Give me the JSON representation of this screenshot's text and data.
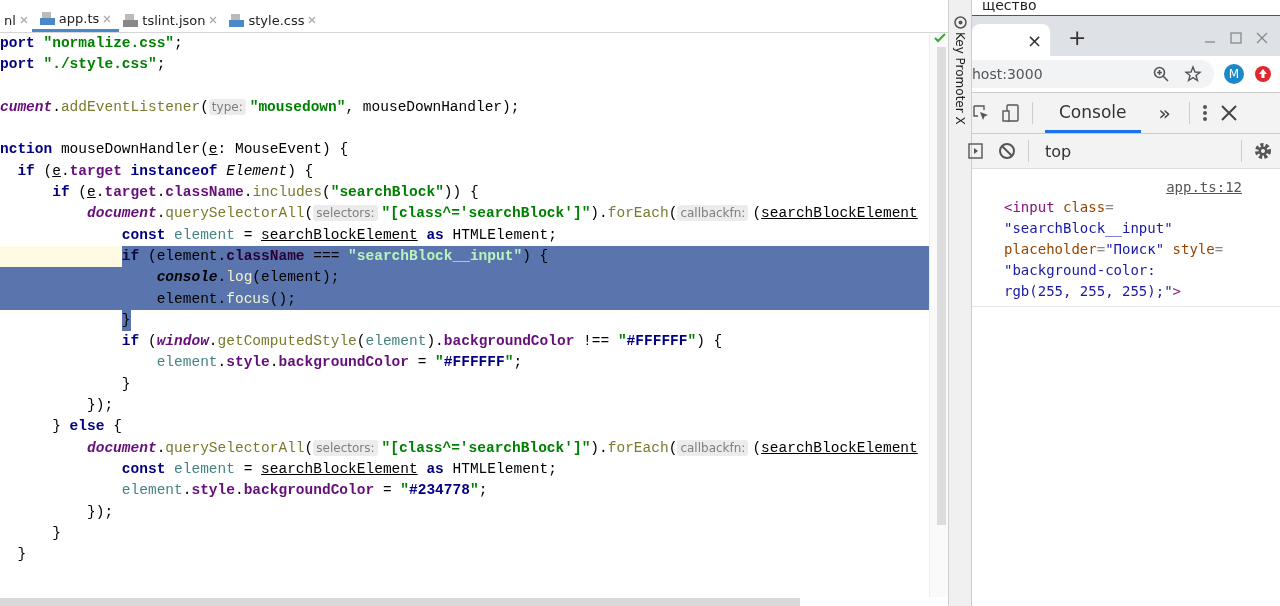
{
  "editor": {
    "tabs": [
      {
        "label": "nl",
        "selected": false,
        "kind": "plain"
      },
      {
        "label": "app.ts",
        "selected": true,
        "kind": "ts"
      },
      {
        "label": "tslint.json",
        "selected": false,
        "kind": "json"
      },
      {
        "label": "style.css",
        "selected": false,
        "kind": "css"
      }
    ],
    "lines": [
      {
        "selected": false,
        "tokens": [
          {
            "kind": "kw",
            "text": "port"
          },
          {
            "kind": "str",
            "text": " \"normalize.css\""
          },
          {
            "kind": "plain",
            "text": ";"
          }
        ]
      },
      {
        "selected": false,
        "tokens": [
          {
            "kind": "kw",
            "text": "port"
          },
          {
            "kind": "str",
            "text": " \"./style.css\""
          },
          {
            "kind": "plain",
            "text": ";"
          }
        ]
      },
      {
        "selected": false
      },
      {
        "selected": false,
        "tokens": [
          {
            "kind": "glob",
            "text": "cument"
          },
          {
            "kind": "plain",
            "text": "."
          },
          {
            "kind": "fn",
            "text": "addEventListener"
          },
          {
            "kind": "plain",
            "text": "("
          },
          {
            "kind": "hint",
            "text": "type:"
          },
          {
            "kind": "str",
            "text": "\"mousedown\""
          },
          {
            "kind": "plain",
            "text": ", mouseDownHandler);"
          }
        ]
      },
      {
        "selected": false
      },
      {
        "selected": false,
        "tokens": [
          {
            "kind": "kw",
            "text": "nction"
          },
          {
            "kind": "plain",
            "text": " mouseDownHandler("
          },
          {
            "kind": "param",
            "text": "e"
          },
          {
            "kind": "plain",
            "text": ": MouseEvent) {"
          }
        ]
      },
      {
        "selected": false,
        "tokens": [
          {
            "kind": "kw",
            "text": "  if"
          },
          {
            "kind": "plain",
            "text": " ("
          },
          {
            "kind": "param",
            "text": "e"
          },
          {
            "kind": "plain",
            "text": "."
          },
          {
            "kind": "field",
            "text": "target"
          },
          {
            "kind": "kw",
            "text": " instanceof"
          },
          {
            "kind": "type",
            "text": " Element"
          },
          {
            "kind": "plain",
            "text": ") {"
          }
        ]
      },
      {
        "selected": false,
        "tokens": [
          {
            "kind": "kw",
            "text": "      if"
          },
          {
            "kind": "plain",
            "text": " ("
          },
          {
            "kind": "param",
            "text": "e"
          },
          {
            "kind": "plain",
            "text": "."
          },
          {
            "kind": "field",
            "text": "target"
          },
          {
            "kind": "plain",
            "text": "."
          },
          {
            "kind": "field",
            "text": "className"
          },
          {
            "kind": "plain",
            "text": "."
          },
          {
            "kind": "fn",
            "text": "includes"
          },
          {
            "kind": "plain",
            "text": "("
          },
          {
            "kind": "str",
            "text": "\"searchBlock\""
          },
          {
            "kind": "plain",
            "text": ")) {"
          }
        ]
      },
      {
        "selected": false,
        "tokens": [
          {
            "kind": "glob",
            "text": "          document"
          },
          {
            "kind": "plain",
            "text": "."
          },
          {
            "kind": "fn",
            "text": "querySelectorAll"
          },
          {
            "kind": "plain",
            "text": "("
          },
          {
            "kind": "hint",
            "text": "selectors:"
          },
          {
            "kind": "str",
            "text": "\"[class^='searchBlock']\""
          },
          {
            "kind": "plain",
            "text": ")."
          },
          {
            "kind": "fn",
            "text": "forEach"
          },
          {
            "kind": "plain",
            "text": "("
          },
          {
            "kind": "hint",
            "text": "callbackfn:"
          },
          {
            "kind": "plain",
            "text": "("
          },
          {
            "kind": "param",
            "text": "searchBlockElement"
          }
        ]
      },
      {
        "selected": false,
        "tokens": [
          {
            "kind": "kw",
            "text": "              const"
          },
          {
            "kind": "local",
            "text": " element"
          },
          {
            "kind": "plain",
            "text": " = "
          },
          {
            "kind": "param",
            "text": "searchBlockElement"
          },
          {
            "kind": "kw",
            "text": " as"
          },
          {
            "kind": "plain",
            "text": " HTMLElement;"
          }
        ]
      },
      {
        "selected": true,
        "tokens": [
          {
            "kind": "kw",
            "text": "              if"
          },
          {
            "kind": "plain",
            "text": " (element."
          },
          {
            "kind": "field",
            "text": "className"
          },
          {
            "kind": "plain",
            "text": " === "
          },
          {
            "kind": "str",
            "text": "\"searchBlock__input\""
          },
          {
            "kind": "plain",
            "text": ") {"
          }
        ]
      },
      {
        "selected": true,
        "tokens": [
          {
            "kind": "glob",
            "text": "                  console"
          },
          {
            "kind": "plain",
            "text": "."
          },
          {
            "kind": "fn",
            "text": "log"
          },
          {
            "kind": "plain",
            "text": "(element);"
          }
        ]
      },
      {
        "selected": true,
        "tokens": [
          {
            "kind": "plain",
            "text": "                  element."
          },
          {
            "kind": "fn",
            "text": "focus"
          },
          {
            "kind": "plain",
            "text": "();"
          }
        ]
      },
      {
        "selected": true,
        "tokens": [
          {
            "kind": "plain",
            "text": "              }"
          }
        ]
      },
      {
        "selected": false,
        "tokens": [
          {
            "kind": "kw",
            "text": "              if"
          },
          {
            "kind": "plain",
            "text": " ("
          },
          {
            "kind": "glob",
            "text": "window"
          },
          {
            "kind": "plain",
            "text": "."
          },
          {
            "kind": "fn",
            "text": "getComputedStyle"
          },
          {
            "kind": "plain",
            "text": "("
          },
          {
            "kind": "local",
            "text": "element"
          },
          {
            "kind": "plain",
            "text": ")."
          },
          {
            "kind": "field",
            "text": "backgroundColor"
          },
          {
            "kind": "plain",
            "text": " !== "
          },
          {
            "kind": "str",
            "text": "\""
          },
          {
            "kind": "hex",
            "text": "#FFFFFF"
          },
          {
            "kind": "str",
            "text": "\""
          },
          {
            "kind": "plain",
            "text": ") {"
          }
        ]
      },
      {
        "selected": false,
        "tokens": [
          {
            "kind": "local",
            "text": "                  element"
          },
          {
            "kind": "plain",
            "text": "."
          },
          {
            "kind": "field",
            "text": "style"
          },
          {
            "kind": "plain",
            "text": "."
          },
          {
            "kind": "field",
            "text": "backgroundColor"
          },
          {
            "kind": "plain",
            "text": " = "
          },
          {
            "kind": "str",
            "text": "\""
          },
          {
            "kind": "hex",
            "text": "#FFFFFF"
          },
          {
            "kind": "str",
            "text": "\""
          },
          {
            "kind": "plain",
            "text": ";"
          }
        ]
      },
      {
        "selected": false,
        "tokens": [
          {
            "kind": "plain",
            "text": "              }"
          }
        ]
      },
      {
        "selected": false,
        "tokens": [
          {
            "kind": "plain",
            "text": "          });"
          }
        ]
      },
      {
        "selected": false,
        "tokens": [
          {
            "kind": "plain",
            "text": "      }"
          },
          {
            "kind": "kw",
            "text": " else"
          },
          {
            "kind": "plain",
            "text": " {"
          }
        ]
      },
      {
        "selected": false,
        "tokens": [
          {
            "kind": "glob",
            "text": "          document"
          },
          {
            "kind": "plain",
            "text": "."
          },
          {
            "kind": "fn",
            "text": "querySelectorAll"
          },
          {
            "kind": "plain",
            "text": "("
          },
          {
            "kind": "hint",
            "text": "selectors:"
          },
          {
            "kind": "str",
            "text": "\"[class^='searchBlock']\""
          },
          {
            "kind": "plain",
            "text": ")."
          },
          {
            "kind": "fn",
            "text": "forEach"
          },
          {
            "kind": "plain",
            "text": "("
          },
          {
            "kind": "hint",
            "text": "callbackfn:"
          },
          {
            "kind": "plain",
            "text": "("
          },
          {
            "kind": "param",
            "text": "searchBlockElement"
          }
        ]
      },
      {
        "selected": false,
        "tokens": [
          {
            "kind": "kw",
            "text": "              const"
          },
          {
            "kind": "local",
            "text": " element"
          },
          {
            "kind": "plain",
            "text": " = "
          },
          {
            "kind": "param",
            "text": "searchBlockElement"
          },
          {
            "kind": "kw",
            "text": " as"
          },
          {
            "kind": "plain",
            "text": " HTMLElement;"
          }
        ]
      },
      {
        "selected": false,
        "tokens": [
          {
            "kind": "local",
            "text": "              element"
          },
          {
            "kind": "plain",
            "text": "."
          },
          {
            "kind": "field",
            "text": "style"
          },
          {
            "kind": "plain",
            "text": "."
          },
          {
            "kind": "field",
            "text": "backgroundColor"
          },
          {
            "kind": "plain",
            "text": " = "
          },
          {
            "kind": "str",
            "text": "\""
          },
          {
            "kind": "hex",
            "text": "#234778"
          },
          {
            "kind": "str",
            "text": "\""
          },
          {
            "kind": "plain",
            "text": ";"
          }
        ]
      },
      {
        "selected": false,
        "tokens": [
          {
            "kind": "plain",
            "text": "          });"
          }
        ]
      },
      {
        "selected": false,
        "tokens": [
          {
            "kind": "plain",
            "text": "      }"
          }
        ]
      },
      {
        "selected": false,
        "tokens": [
          {
            "kind": "plain",
            "text": "  }"
          }
        ]
      }
    ]
  },
  "side_tool": {
    "label": "Key Promoter X"
  },
  "browser": {
    "behind_text": "щество",
    "tab_close": "×",
    "new_tab": "+",
    "address": "host:3000",
    "avatar": "M",
    "devtools": {
      "tabs": [
        {
          "label": "Console",
          "selected": true
        }
      ],
      "more": "»",
      "context": "top",
      "source_link": "app.ts:12",
      "output": [
        {
          "tokens": [
            {
              "kind": "tag",
              "text": "<input"
            },
            {
              "kind": "attr",
              "text": " class"
            },
            {
              "kind": "eq",
              "text": "="
            }
          ]
        },
        {
          "tokens": [
            {
              "kind": "val",
              "text": "\"searchBlock__input\""
            }
          ]
        },
        {
          "tokens": [
            {
              "kind": "attr",
              "text": "placeholder"
            },
            {
              "kind": "eq",
              "text": "="
            },
            {
              "kind": "val",
              "text": "\"Поиск\""
            },
            {
              "kind": "attr",
              "text": " style"
            },
            {
              "kind": "eq",
              "text": "="
            }
          ]
        },
        {
          "tokens": [
            {
              "kind": "val",
              "text": "\"background-color:"
            }
          ]
        },
        {
          "tokens": [
            {
              "kind": "val",
              "text": "rgb(255, 255, 255);\""
            },
            {
              "kind": "tag",
              "text": ">"
            }
          ]
        }
      ]
    }
  }
}
